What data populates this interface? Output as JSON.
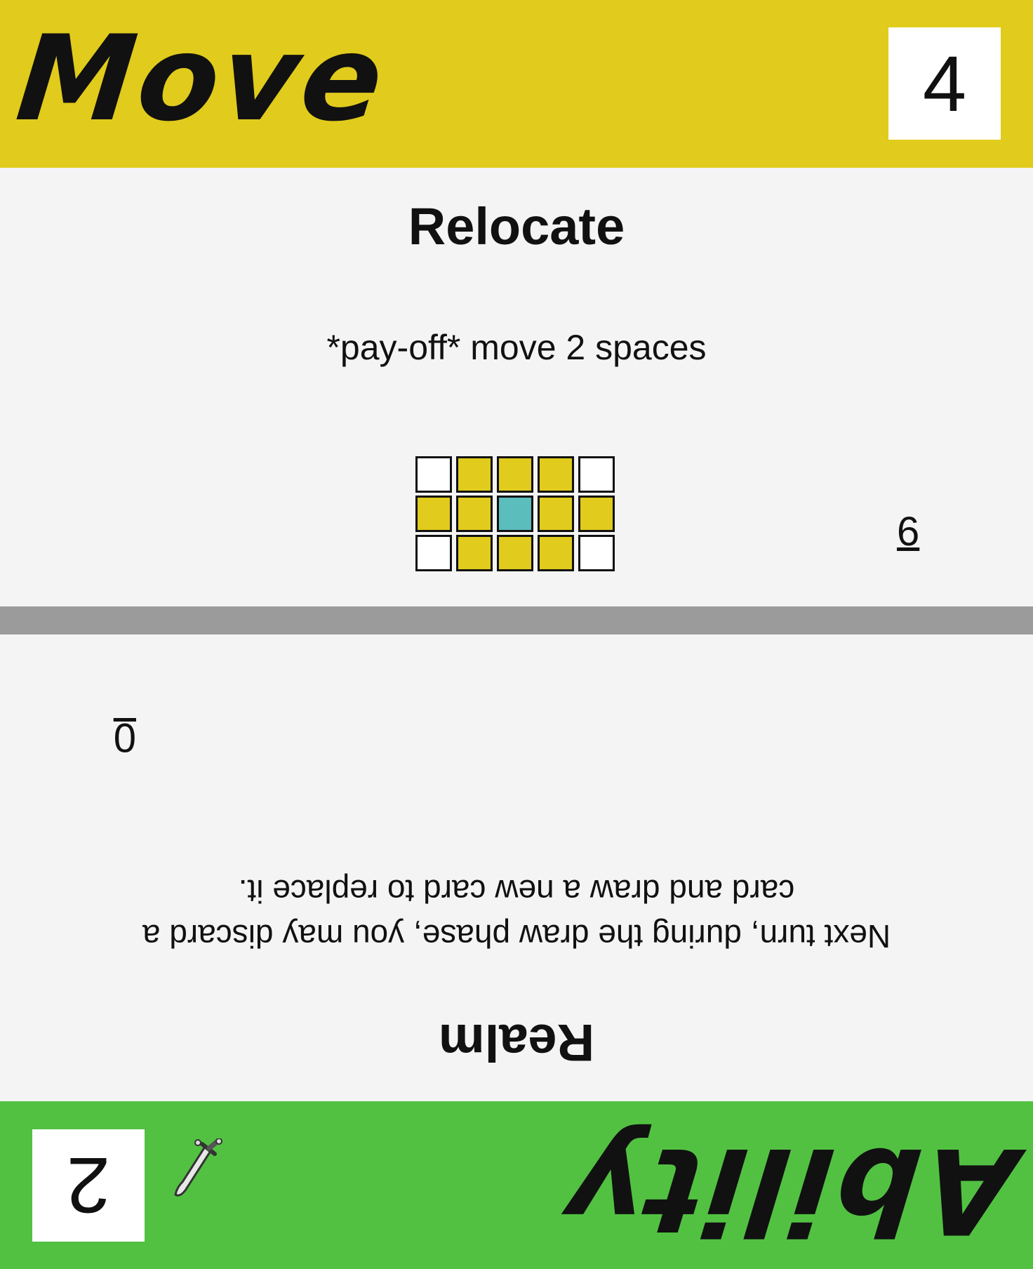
{
  "top": {
    "category": "Move",
    "cost": "4",
    "title": "Relocate",
    "text": "*pay-off* move 2 spaces",
    "corner_number": "6",
    "colors": {
      "band": "#e1cb1c"
    },
    "grid": [
      [
        "white",
        "yellow",
        "yellow",
        "yellow",
        "white"
      ],
      [
        "yellow",
        "yellow",
        "teal",
        "yellow",
        "yellow"
      ],
      [
        "white",
        "yellow",
        "yellow",
        "yellow",
        "white"
      ]
    ]
  },
  "bottom": {
    "category": "Ability",
    "cost": "2",
    "title": "Realm",
    "text": "Next turn, during the draw phase, you may discard a card and draw a new card to replace it.",
    "corner_number": "0",
    "icon": "sword-icon",
    "colors": {
      "band": "#52c142"
    }
  },
  "colors": {
    "divider": "#9b9b9b",
    "background": "#f4f4f4",
    "teal": "#5bbdbc"
  }
}
